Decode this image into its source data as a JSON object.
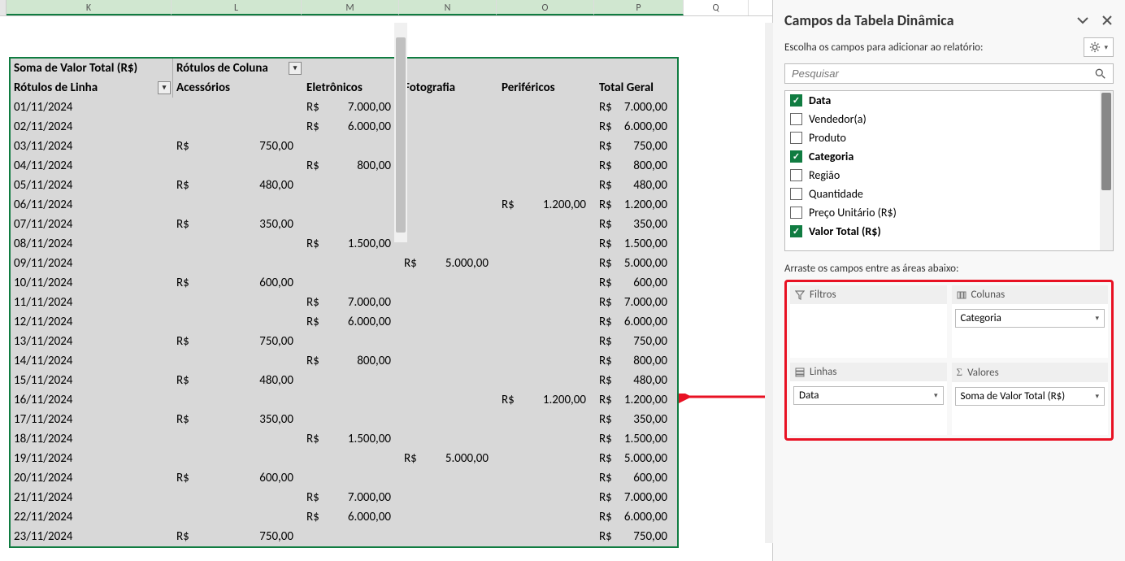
{
  "columns": [
    "K",
    "L",
    "M",
    "N",
    "O",
    "P",
    "Q"
  ],
  "pivot": {
    "top_left": "Soma de Valor Total (R$)",
    "col_label": "Rótulos de Coluna",
    "row_label": "Rótulos de Linha",
    "col_headers": [
      "Acessórios",
      "Eletrônicos",
      "Fotografia",
      "Periféricos",
      "Total Geral"
    ],
    "rows": [
      {
        "d": "01/11/2024",
        "ac": "",
        "el": "7.000,00",
        "fo": "",
        "pe": "",
        "tg": "7.000,00"
      },
      {
        "d": "02/11/2024",
        "ac": "",
        "el": "6.000,00",
        "fo": "",
        "pe": "",
        "tg": "6.000,00"
      },
      {
        "d": "03/11/2024",
        "ac": "750,00",
        "el": "",
        "fo": "",
        "pe": "",
        "tg": "750,00"
      },
      {
        "d": "04/11/2024",
        "ac": "",
        "el": "800,00",
        "fo": "",
        "pe": "",
        "tg": "800,00"
      },
      {
        "d": "05/11/2024",
        "ac": "480,00",
        "el": "",
        "fo": "",
        "pe": "",
        "tg": "480,00"
      },
      {
        "d": "06/11/2024",
        "ac": "",
        "el": "",
        "fo": "",
        "pe": "1.200,00",
        "tg": "1.200,00"
      },
      {
        "d": "07/11/2024",
        "ac": "350,00",
        "el": "",
        "fo": "",
        "pe": "",
        "tg": "350,00"
      },
      {
        "d": "08/11/2024",
        "ac": "",
        "el": "1.500,00",
        "fo": "",
        "pe": "",
        "tg": "1.500,00"
      },
      {
        "d": "09/11/2024",
        "ac": "",
        "el": "",
        "fo": "5.000,00",
        "pe": "",
        "tg": "5.000,00"
      },
      {
        "d": "10/11/2024",
        "ac": "600,00",
        "el": "",
        "fo": "",
        "pe": "",
        "tg": "600,00"
      },
      {
        "d": "11/11/2024",
        "ac": "",
        "el": "7.000,00",
        "fo": "",
        "pe": "",
        "tg": "7.000,00"
      },
      {
        "d": "12/11/2024",
        "ac": "",
        "el": "6.000,00",
        "fo": "",
        "pe": "",
        "tg": "6.000,00"
      },
      {
        "d": "13/11/2024",
        "ac": "750,00",
        "el": "",
        "fo": "",
        "pe": "",
        "tg": "750,00"
      },
      {
        "d": "14/11/2024",
        "ac": "",
        "el": "800,00",
        "fo": "",
        "pe": "",
        "tg": "800,00"
      },
      {
        "d": "15/11/2024",
        "ac": "480,00",
        "el": "",
        "fo": "",
        "pe": "",
        "tg": "480,00"
      },
      {
        "d": "16/11/2024",
        "ac": "",
        "el": "",
        "fo": "",
        "pe": "1.200,00",
        "tg": "1.200,00"
      },
      {
        "d": "17/11/2024",
        "ac": "350,00",
        "el": "",
        "fo": "",
        "pe": "",
        "tg": "350,00"
      },
      {
        "d": "18/11/2024",
        "ac": "",
        "el": "1.500,00",
        "fo": "",
        "pe": "",
        "tg": "1.500,00"
      },
      {
        "d": "19/11/2024",
        "ac": "",
        "el": "",
        "fo": "5.000,00",
        "pe": "",
        "tg": "5.000,00"
      },
      {
        "d": "20/11/2024",
        "ac": "600,00",
        "el": "",
        "fo": "",
        "pe": "",
        "tg": "600,00"
      },
      {
        "d": "21/11/2024",
        "ac": "",
        "el": "7.000,00",
        "fo": "",
        "pe": "",
        "tg": "7.000,00"
      },
      {
        "d": "22/11/2024",
        "ac": "",
        "el": "6.000,00",
        "fo": "",
        "pe": "",
        "tg": "6.000,00"
      },
      {
        "d": "23/11/2024",
        "ac": "750,00",
        "el": "",
        "fo": "",
        "pe": "",
        "tg": "750,00"
      }
    ],
    "currency": "R$"
  },
  "pane": {
    "title": "Campos da Tabela Dinâmica",
    "subtitle": "Escolha os campos para adicionar ao relatório:",
    "search_placeholder": "Pesquisar",
    "fields": [
      {
        "label": "Data",
        "checked": true
      },
      {
        "label": "Vendedor(a)",
        "checked": false
      },
      {
        "label": "Produto",
        "checked": false
      },
      {
        "label": "Categoria",
        "checked": true
      },
      {
        "label": "Região",
        "checked": false
      },
      {
        "label": "Quantidade",
        "checked": false
      },
      {
        "label": "Preço Unitário (R$)",
        "checked": false
      },
      {
        "label": "Valor Total (R$)",
        "checked": true
      }
    ],
    "drag_label": "Arraste os campos entre as áreas abaixo:",
    "areas": {
      "filters": "Filtros",
      "columns": "Colunas",
      "rows": "Linhas",
      "values": "Valores",
      "columns_tag": "Categoria",
      "rows_tag": "Data",
      "values_tag": "Soma de Valor Total (R$)"
    }
  }
}
